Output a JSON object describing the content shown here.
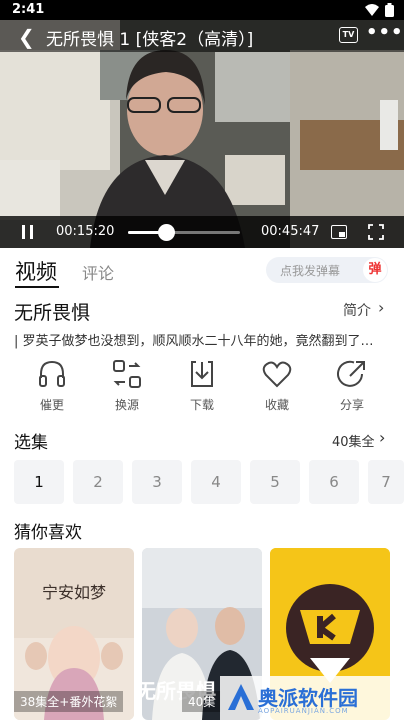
{
  "status_bar": {
    "time": "2:41"
  },
  "player": {
    "title": "无所畏惧 1 [侠客2（高清）]",
    "tv_label": "TV",
    "current_time": "00:15:20",
    "total_time": "00:45:47",
    "progress": 0.335
  },
  "tabs": {
    "video": "视频",
    "comments": "评论"
  },
  "danmaku": {
    "placeholder": "点我发弹幕",
    "button": "弹"
  },
  "show": {
    "title": "无所畏惧",
    "intro_label": "简介",
    "description": "| 罗英子做梦也没想到，顺风顺水二十八年的她，竟然翻到了…"
  },
  "actions": [
    {
      "label": "催更",
      "icon": "headphones-icon"
    },
    {
      "label": "换源",
      "icon": "switch-source-icon"
    },
    {
      "label": "下载",
      "icon": "download-icon"
    },
    {
      "label": "收藏",
      "icon": "heart-icon"
    },
    {
      "label": "分享",
      "icon": "share-icon"
    }
  ],
  "episodes": {
    "title": "选集",
    "count_label": "40集全",
    "items": [
      "1",
      "2",
      "3",
      "4",
      "5",
      "6",
      "7"
    ]
  },
  "recommend": {
    "title": "猜你喜欢",
    "cards": [
      {
        "tag": "38集全+番外花絮",
        "title": "宁安如梦"
      },
      {
        "tag": "40集",
        "title": "无所畏惧"
      }
    ]
  },
  "watermark": {
    "text": "奥派软件园",
    "sub": "AOPAIRUANJIAN.COM"
  }
}
